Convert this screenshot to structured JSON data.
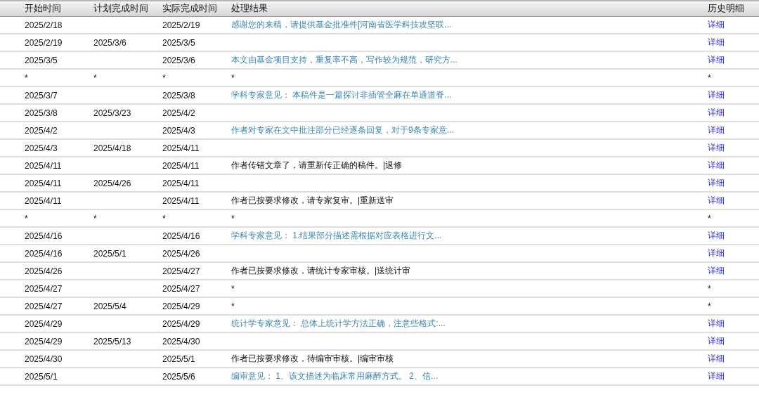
{
  "table": {
    "columns": [
      "开始时间",
      "计划完成时间",
      "实际完成时间",
      "处理结果",
      "历史明细"
    ],
    "rows": [
      {
        "start": "2025/2/18",
        "actual": "2025/2/19",
        "result": {
          "kind": "link",
          "text": "感谢您的来稿，请提供基金批准件[河南省医学科技攻坚联..."
        },
        "detail": {
          "kind": "link",
          "text": "详细"
        }
      },
      {
        "start": "2025/2/19",
        "planned": "2025/3/6",
        "actual": "2025/3/5",
        "detail": {
          "kind": "link",
          "text": "详细"
        }
      },
      {
        "start": "2025/3/5",
        "actual": "2025/3/6",
        "result": {
          "kind": "link",
          "text": "本文由基金项目支持，重复率不高，写作较为规范，研究方..."
        },
        "detail": {
          "kind": "link",
          "text": "详细"
        }
      },
      {
        "start": "*",
        "planned": "*",
        "actual": "*",
        "result": {
          "kind": "plain",
          "text": "*"
        },
        "detail": {
          "kind": "plain",
          "text": "*"
        }
      },
      {
        "start": "2025/3/7",
        "actual": "2025/3/8",
        "result": {
          "kind": "link",
          "text": "学科专家意见： 本稿件是一篇探讨非插管全麻在单通道脊..."
        },
        "detail": {
          "kind": "link",
          "text": "详细"
        }
      },
      {
        "start": "2025/3/8",
        "planned": "2025/3/23",
        "actual": "2025/4/2",
        "detail": {
          "kind": "link",
          "text": "详细"
        }
      },
      {
        "start": "2025/4/2",
        "actual": "2025/4/3",
        "result": {
          "kind": "link",
          "text": "作者对专家在文中批注部分已经逐条回复，对于9条专家意..."
        },
        "detail": {
          "kind": "link",
          "text": "详细"
        }
      },
      {
        "start": "2025/4/3",
        "planned": "2025/4/18",
        "actual": "2025/4/11",
        "detail": {
          "kind": "link",
          "text": "详细"
        }
      },
      {
        "start": "2025/4/11",
        "actual": "2025/4/11",
        "result": {
          "kind": "plain",
          "text": "作者传错文章了，请重新传正确的稿件。|退修"
        },
        "detail": {
          "kind": "link",
          "text": "详细"
        }
      },
      {
        "start": "2025/4/11",
        "planned": "2025/4/26",
        "actual": "2025/4/11",
        "detail": {
          "kind": "link",
          "text": "详细"
        }
      },
      {
        "start": "2025/4/11",
        "actual": "2025/4/11",
        "result": {
          "kind": "plain",
          "text": "作者已按要求修改，请专家复审。|重新送审"
        },
        "detail": {
          "kind": "link",
          "text": "详细"
        }
      },
      {
        "start": "*",
        "planned": "*",
        "actual": "*",
        "result": {
          "kind": "plain",
          "text": "*"
        },
        "detail": {
          "kind": "plain",
          "text": "*"
        }
      },
      {
        "start": "2025/4/16",
        "actual": "2025/4/16",
        "result": {
          "kind": "link",
          "text": "学科专家意见： 1.结果部分描述需根据对应表格进行文..."
        },
        "detail": {
          "kind": "link",
          "text": "详细"
        }
      },
      {
        "start": "2025/4/16",
        "planned": "2025/5/1",
        "actual": "2025/4/26",
        "detail": {
          "kind": "link",
          "text": "详细"
        }
      },
      {
        "start": "2025/4/26",
        "actual": "2025/4/27",
        "result": {
          "kind": "plain",
          "text": "作者已按要求修改，请统计专家审核。|送统计审"
        },
        "detail": {
          "kind": "link",
          "text": "详细"
        }
      },
      {
        "start": "2025/4/27",
        "actual": "2025/4/27",
        "result": {
          "kind": "plain",
          "text": "*"
        },
        "detail": {
          "kind": "plain",
          "text": "*"
        }
      },
      {
        "start": "2025/4/27",
        "planned": "2025/5/4",
        "actual": "2025/4/29",
        "result": {
          "kind": "plain",
          "text": "*"
        },
        "detail": {
          "kind": "plain",
          "text": "*"
        }
      },
      {
        "start": "2025/4/29",
        "actual": "2025/4/29",
        "result": {
          "kind": "link",
          "text": "统计学专家意见： 总体上统计学方法正确，注意些格式:..."
        },
        "detail": {
          "kind": "link",
          "text": "详细"
        }
      },
      {
        "start": "2025/4/29",
        "planned": "2025/5/13",
        "actual": "2025/4/30",
        "detail": {
          "kind": "link",
          "text": "详细"
        }
      },
      {
        "start": "2025/4/30",
        "actual": "2025/5/1",
        "result": {
          "kind": "plain",
          "text": "作者已按要求修改，待编审审核。|编审审核"
        },
        "detail": {
          "kind": "link",
          "text": "详细"
        }
      },
      {
        "start": "2025/5/1",
        "actual": "2025/5/6",
        "result": {
          "kind": "link",
          "text": "编审意见： 1、该文描述为临床常用麻醉方式。 2、信..."
        },
        "detail": {
          "kind": "link",
          "text": "详细"
        }
      }
    ]
  }
}
